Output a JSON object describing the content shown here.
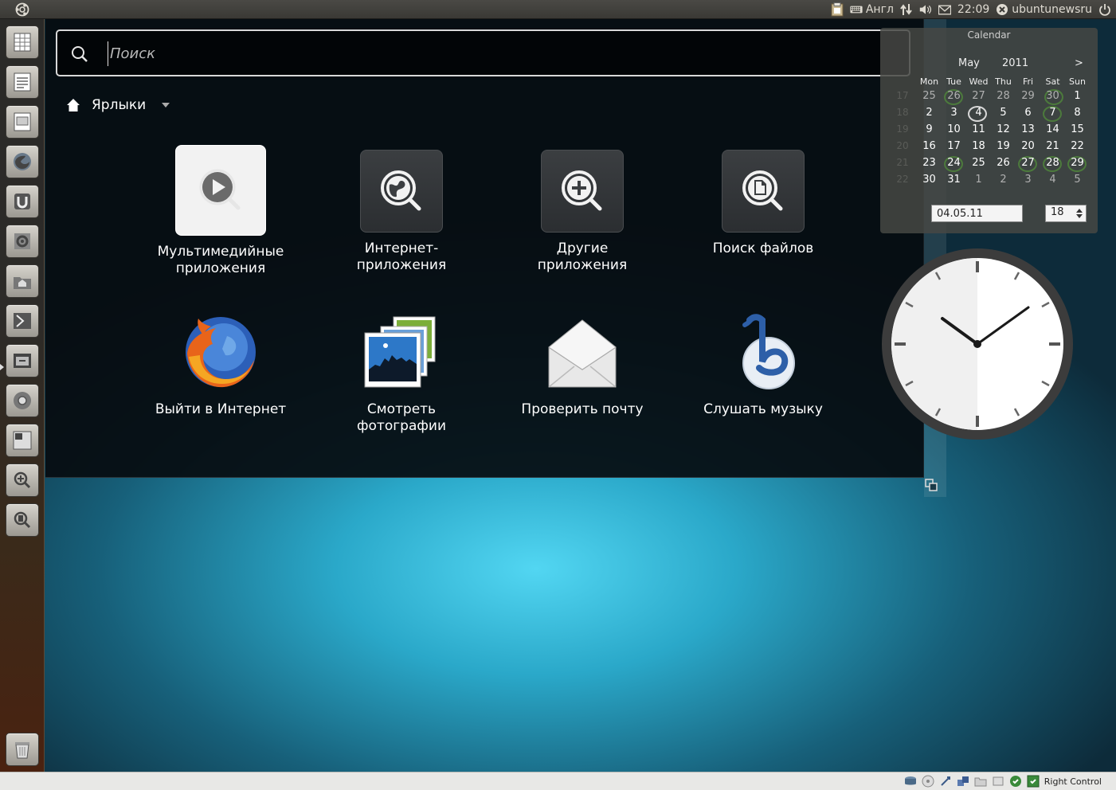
{
  "top_panel": {
    "keyboard_layout": "Англ",
    "time": "22:09",
    "user": "ubuntunewsru"
  },
  "dash": {
    "search": {
      "placeholder": "Поиск",
      "value": ""
    },
    "lens": {
      "label": "Ярлыки"
    },
    "shortcuts": [
      {
        "label_line1": "Мультимедийные",
        "label_line2": "приложения",
        "icon": "media-play-icon"
      },
      {
        "label_line1": "Интернет-",
        "label_line2": "приложения",
        "icon": "internet-lens-icon"
      },
      {
        "label_line1": "Другие",
        "label_line2": "приложения",
        "icon": "other-apps-lens-icon"
      },
      {
        "label_line1": "Поиск файлов",
        "label_line2": "",
        "icon": "file-search-lens-icon"
      },
      {
        "label_line1": "Выйти в Интернет",
        "label_line2": "",
        "icon": "firefox-icon"
      },
      {
        "label_line1": "Смотреть",
        "label_line2": "фотографии",
        "icon": "photos-icon"
      },
      {
        "label_line1": "Проверить почту",
        "label_line2": "",
        "icon": "mail-icon"
      },
      {
        "label_line1": "Слушать музыку",
        "label_line2": "",
        "icon": "banshee-music-icon"
      }
    ]
  },
  "launcher": {
    "items": [
      "spreadsheet-icon",
      "document-icon",
      "presentation-icon",
      "firefox-icon",
      "ubuntu-one-icon",
      "settings-icon",
      "home-folder-icon",
      "workspaces-icon",
      "window-switcher-icon",
      "chromium-icon",
      "show-desktop-icon",
      "app-lens-icon",
      "file-lens-icon",
      "trash-icon"
    ]
  },
  "calendar": {
    "title": "Calendar",
    "month": "May",
    "year": "2011",
    "next": ">",
    "dow": [
      "Mon",
      "Tue",
      "Wed",
      "Thu",
      "Fri",
      "Sat",
      "Sun"
    ],
    "weeks": [
      "17",
      "18",
      "19",
      "20",
      "21",
      "22"
    ],
    "rows": [
      [
        "25",
        "26",
        "27",
        "28",
        "29",
        "30",
        "1"
      ],
      [
        "2",
        "3",
        "4",
        "5",
        "6",
        "7",
        "8"
      ],
      [
        "9",
        "10",
        "11",
        "12",
        "13",
        "14",
        "15"
      ],
      [
        "16",
        "17",
        "18",
        "19",
        "20",
        "21",
        "22"
      ],
      [
        "23",
        "24",
        "25",
        "26",
        "27",
        "28",
        "29"
      ],
      [
        "30",
        "31",
        "1",
        "2",
        "3",
        "4",
        "5"
      ]
    ],
    "date_value": "04.05.11",
    "spin_value": "18"
  },
  "status_bar": {
    "host_key": "Right Control"
  },
  "colors": {
    "dash_bg": "#060c10",
    "launcher_tile": "#c8c5be",
    "accent_green": "#4c7a3c",
    "desktop_cyan": "#52d6f2"
  }
}
